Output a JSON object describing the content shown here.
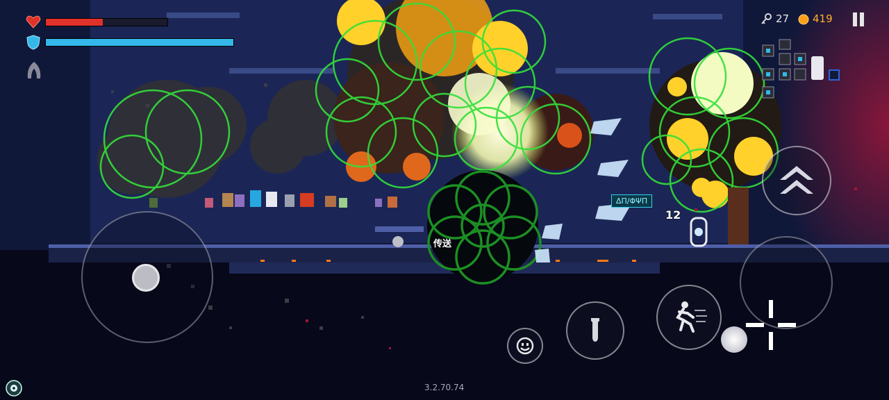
{
  "player": {
    "health_fraction": 0.47,
    "armor_fraction": 1.0,
    "health_color": "#e0322b",
    "armor_color": "#34b8ea"
  },
  "resources": {
    "keys_icon": "key-icon",
    "keys": "27",
    "coins_icon": "coin-icon",
    "coins": "419"
  },
  "controls": {
    "pause_icon": "pause-icon",
    "jump_icon": "double-chevron-up-icon",
    "dash_icon": "running-figure-icon",
    "item_icon": "potion-icon",
    "emote_icon": "smiley-icon",
    "aim_icon": "crosshair-icon"
  },
  "world": {
    "teleport_label": "传送",
    "weapon_ammo": "12",
    "shop_sign": "ΔΠ/ΦΨΠ"
  },
  "version": "3.2.70.74",
  "colors": {
    "explosion_green": "#33e03a",
    "background": "#07081a"
  }
}
